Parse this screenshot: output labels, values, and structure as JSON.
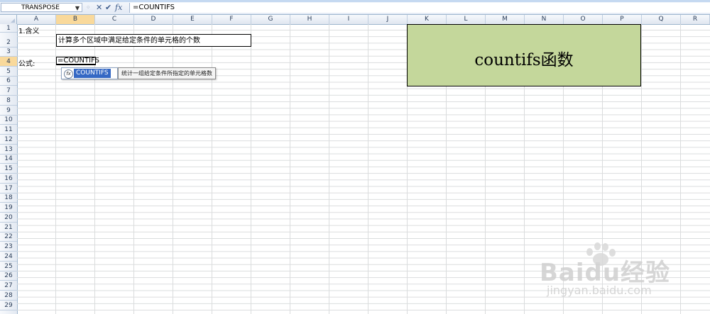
{
  "formula_bar": {
    "name_box": "TRANSPOSE",
    "cancel_icon": "close-icon",
    "enter_icon": "check-icon",
    "fx_label": "fx",
    "formula": "=COUNTIFS"
  },
  "columns": [
    "A",
    "B",
    "C",
    "D",
    "E",
    "F",
    "G",
    "H",
    "I",
    "J",
    "K",
    "L",
    "M",
    "N",
    "O",
    "P",
    "Q",
    "R"
  ],
  "selected_column": "B",
  "rows": [
    "1",
    "2",
    "3",
    "4",
    "5",
    "6",
    "7",
    "8",
    "9",
    "10",
    "11",
    "12",
    "13",
    "14",
    "15",
    "16",
    "17",
    "18",
    "19",
    "20",
    "21",
    "22",
    "23",
    "24",
    "25",
    "26",
    "27",
    "28",
    "29"
  ],
  "selected_row": "4",
  "cells": {
    "a1": "1.含义",
    "b2": "计算多个区域中满足给定条件的单元格的个数",
    "a4": "公式:",
    "b4": "=COUNTIFS"
  },
  "autocomplete": {
    "icon": "function-icon",
    "option": "COUNTIFS",
    "tooltip": "统计一组给定条件所指定的单元格数"
  },
  "title_box": {
    "text": "countifs函数",
    "fill_color": "#c4d79b"
  },
  "watermark": {
    "brand": "Baidu经验",
    "url": "jingyan.baidu.com"
  }
}
